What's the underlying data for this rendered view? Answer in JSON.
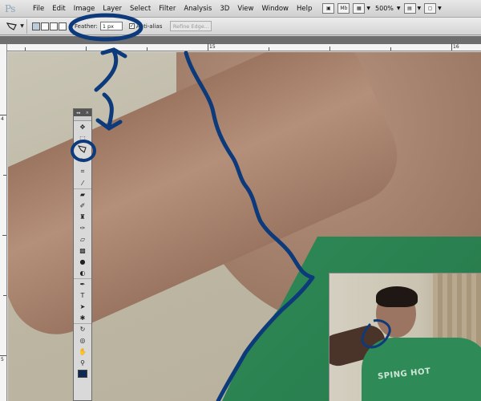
{
  "app": {
    "logo": "Ps",
    "menu": [
      "File",
      "Edit",
      "Image",
      "Layer",
      "Select",
      "Filter",
      "Analysis",
      "3D",
      "View",
      "Window",
      "Help"
    ],
    "mb_button_label": "Mb",
    "zoom": "500%"
  },
  "options": {
    "feather_label": "Feather:",
    "feather_value": "1 px",
    "antialias_label": "Anti-alias",
    "antialias_checked": "✓",
    "refine_label": "Refine Edge..."
  },
  "rulers": {
    "top": [
      "15",
      "16"
    ],
    "left": [
      "4",
      "5"
    ]
  },
  "inset": {
    "shirt_text": "SPING HOT"
  },
  "colors": {
    "annotation": "#0d3a7a",
    "shirt": "#2d8a57",
    "foreground_swatch": "#0e2a52"
  }
}
